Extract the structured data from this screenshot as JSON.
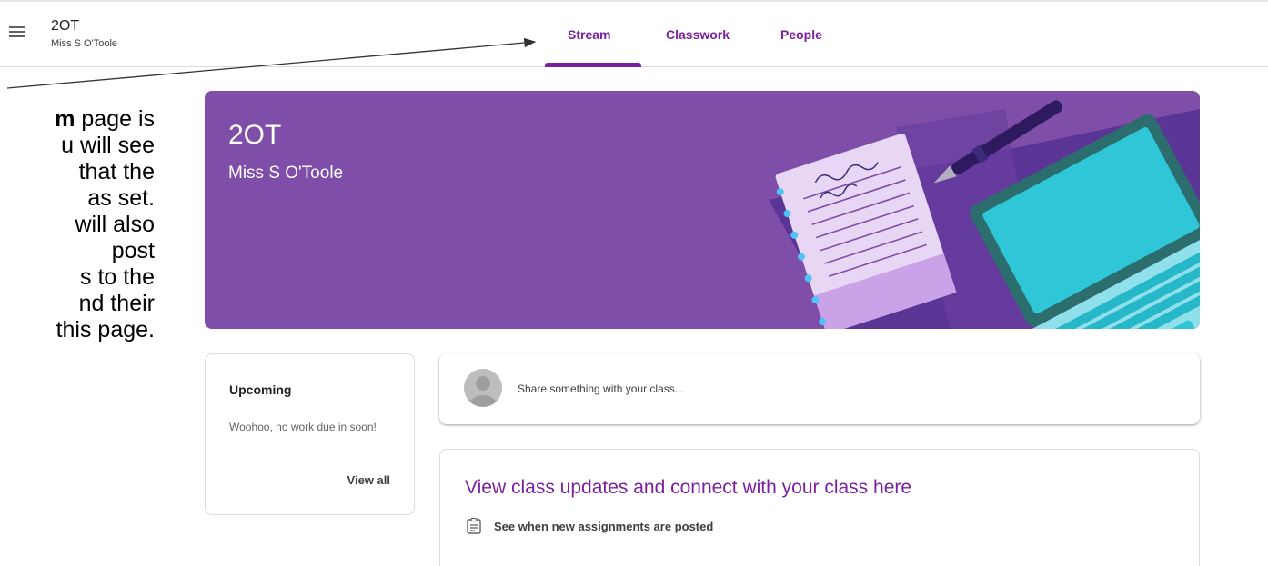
{
  "header": {
    "class_name": "2OT",
    "teacher": "Miss S O'Toole",
    "tabs": [
      "Stream",
      "Classwork",
      "People"
    ],
    "active_tab": "Stream",
    "accent_color": "#7b1fa2"
  },
  "annotation": {
    "lines": [
      {
        "bold": "m",
        "rest": " page is"
      },
      {
        "bold": "",
        "rest": "u will see"
      },
      {
        "bold": "",
        "rest": "that the"
      },
      {
        "bold": "",
        "rest": "as set."
      },
      {
        "bold": "",
        "rest": "will also"
      },
      {
        "bold": "",
        "rest": "post"
      },
      {
        "bold": "",
        "rest": "s to the"
      },
      {
        "bold": "",
        "rest": "nd their"
      },
      {
        "bold": "",
        "rest": "this page."
      }
    ]
  },
  "banner": {
    "title": "2OT",
    "subtitle": "Miss S O'Toole",
    "color": "#7e4ea8"
  },
  "upcoming": {
    "title": "Upcoming",
    "text": "Woohoo, no work due in soon!",
    "link": "View all"
  },
  "share": {
    "placeholder": "Share something with your class..."
  },
  "updates": {
    "title": "View class updates and connect with your class here",
    "item": "See when new assignments are posted",
    "item_icon": "assignment-icon"
  },
  "icons": {
    "menu": "menu-icon",
    "avatar": "avatar-icon"
  }
}
